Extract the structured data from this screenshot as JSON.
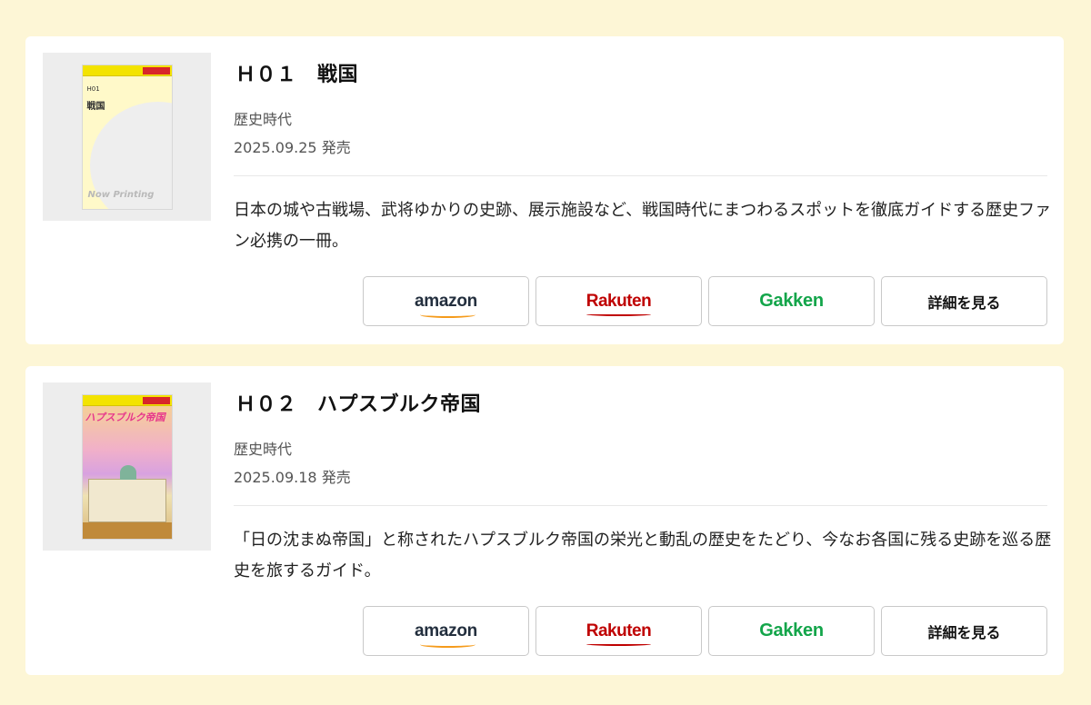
{
  "books": [
    {
      "title": "Ｈ０１　戦国",
      "category": "歴史時代",
      "date": "2025.09.25 発売",
      "description": "日本の城や古戦場、武将ゆかりの史跡、展示施設など、戦国時代にまつわるスポットを徹底ガイドする歴史ファン必携の一冊。",
      "cover": {
        "type": "placeholder",
        "code": "H01",
        "name": "戦国",
        "status": "Now Printing"
      },
      "buttons": {
        "amazon": "amazon",
        "rakuten": "Rakuten",
        "gakken": "Gakken",
        "detail": "詳細を見る"
      }
    },
    {
      "title": "Ｈ０２　ハプスブルク帝国",
      "category": "歴史時代",
      "date": "2025.09.18 発売",
      "description": "「日の沈まぬ帝国」と称されたハプスブルク帝国の栄光と動乱の歴史をたどり、今なお各国に残る史跡を巡る歴史を旅するガイド。",
      "cover": {
        "type": "art",
        "name": "ハプスブルク帝国"
      },
      "buttons": {
        "amazon": "amazon",
        "rakuten": "Rakuten",
        "gakken": "Gakken",
        "detail": "詳細を見る"
      }
    }
  ],
  "colors": {
    "page_background": "#fdf6d6",
    "amazon_smile": "#f59b1b",
    "rakuten_red": "#bf0000",
    "gakken_green": "#13a54a"
  }
}
